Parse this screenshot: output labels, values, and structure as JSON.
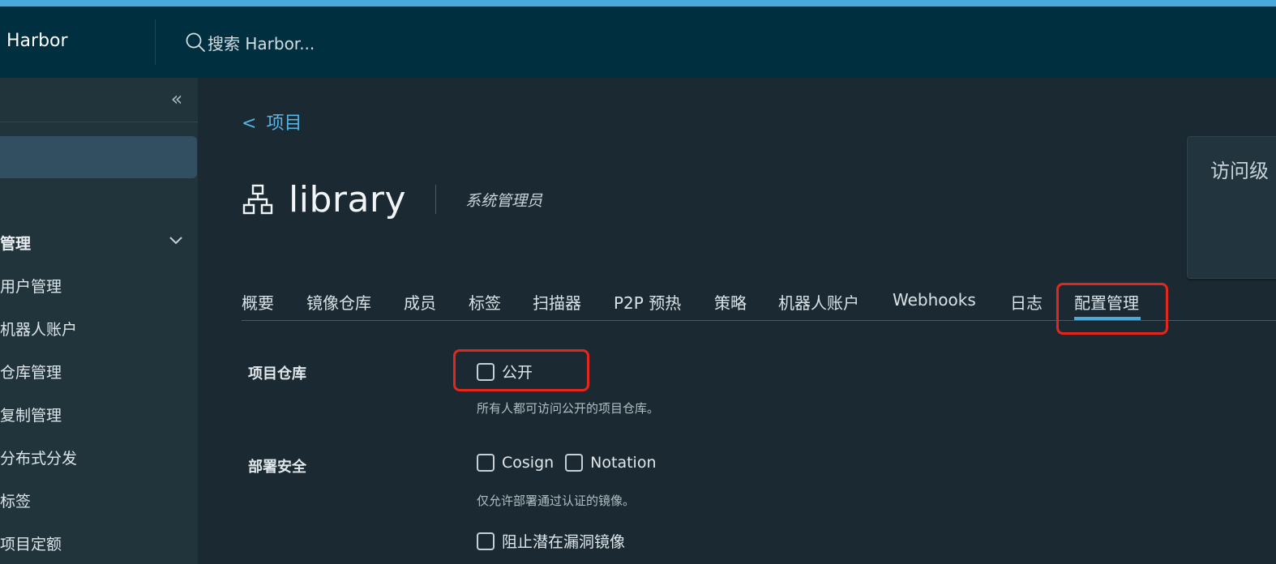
{
  "header": {
    "brand": "Harbor",
    "search_placeholder": "搜索 Harbor..."
  },
  "sidebar": {
    "collapse_glyph": "«",
    "group_label": "管理",
    "items": [
      {
        "label": "用户管理"
      },
      {
        "label": "机器人账户"
      },
      {
        "label": "仓库管理"
      },
      {
        "label": "复制管理"
      },
      {
        "label": "分布式分发"
      },
      {
        "label": "标签"
      },
      {
        "label": "项目定额"
      }
    ]
  },
  "breadcrumb": {
    "back_glyph": "<",
    "label": "项目"
  },
  "project": {
    "name": "library",
    "role": "系统管理员"
  },
  "info_card": {
    "title": "访问级"
  },
  "tabs": [
    {
      "label": "概要"
    },
    {
      "label": "镜像仓库"
    },
    {
      "label": "成员"
    },
    {
      "label": "标签"
    },
    {
      "label": "扫描器"
    },
    {
      "label": "P2P 预热"
    },
    {
      "label": "策略"
    },
    {
      "label": "机器人账户"
    },
    {
      "label": "Webhooks"
    },
    {
      "label": "日志"
    },
    {
      "label": "配置管理"
    }
  ],
  "active_tab": "配置管理",
  "config": {
    "project_registry": {
      "label": "项目仓库",
      "public_label": "公开",
      "public_checked": false,
      "helper": "所有人都可访问公开的项目仓库。"
    },
    "deployment_security": {
      "label": "部署安全",
      "cosign_label": "Cosign",
      "cosign_checked": false,
      "notation_label": "Notation",
      "notation_checked": false,
      "helper": "仅允许部署通过认证的镜像。",
      "prevent_vuln_label": "阻止潜在漏洞镜像",
      "prevent_vuln_checked": false
    }
  },
  "colors": {
    "accent": "#49a9da",
    "highlight": "#e5261c",
    "header_bg": "#00303f",
    "body_bg": "#1b2a32"
  }
}
